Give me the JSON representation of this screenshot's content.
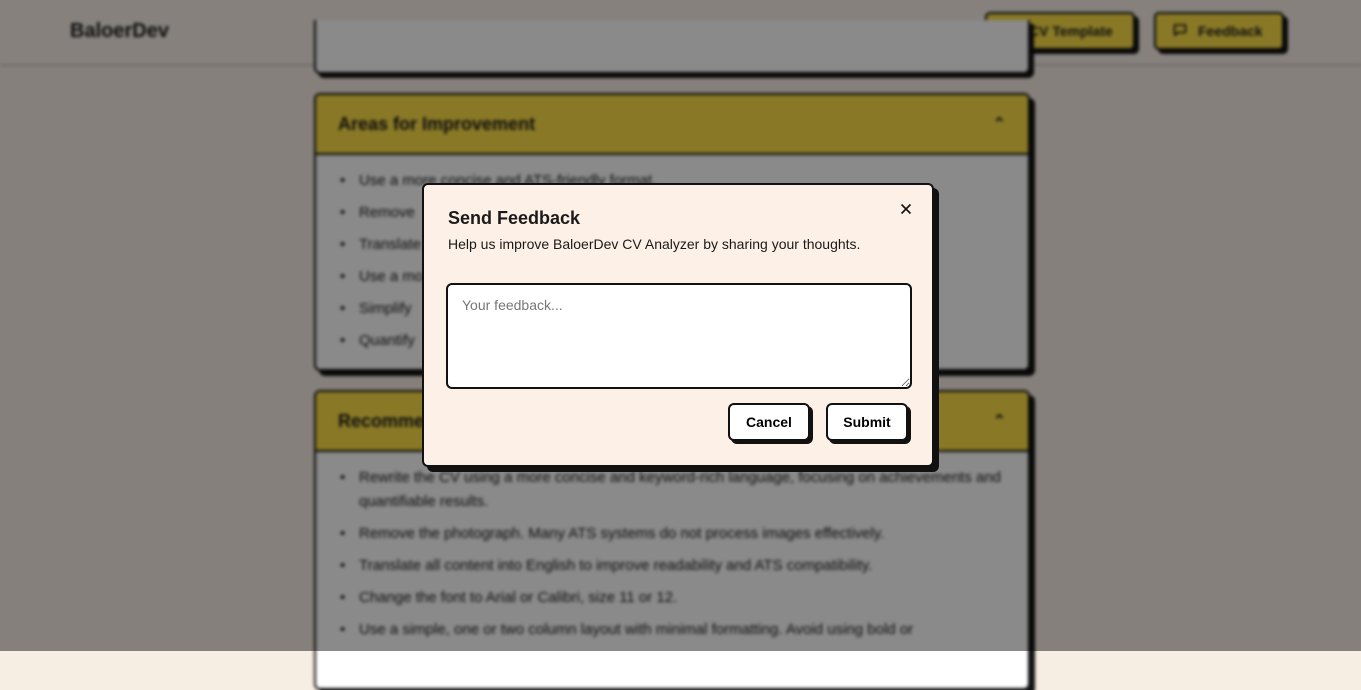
{
  "header": {
    "brand": "BaloerDev",
    "cv_template_label": "CV Template",
    "feedback_label": "Feedback"
  },
  "improvement_card": {
    "title": "Areas for Improvement",
    "items": [
      "Use a more concise and ATS-friendly format.",
      "Remove",
      "Translate",
      "Use a mo",
      "Simplify",
      "Quantify"
    ]
  },
  "recommend_card": {
    "title": "Recommen",
    "items": [
      "Rewrite the CV using a more concise and keyword-rich language, focusing on achievements and quantifiable results.",
      "Remove the photograph. Many ATS systems do not process images effectively.",
      "Translate all content into English to improve readability and ATS compatibility.",
      "Change the font to Arial or Calibri, size 11 or 12.",
      "Use a simple, one or two column layout with minimal formatting. Avoid using bold or"
    ]
  },
  "modal": {
    "title": "Send Feedback",
    "description": "Help us improve BaloerDev CV Analyzer by sharing your thoughts.",
    "feedback_value": "",
    "feedback_placeholder": "Your feedback...",
    "cancel_label": "Cancel",
    "submit_label": "Submit",
    "close_icon": "close-icon"
  },
  "colors": {
    "accent": "#fde047",
    "modal_bg": "#fdf0e6",
    "page_bg": "#f6ede3",
    "border": "#111111"
  }
}
